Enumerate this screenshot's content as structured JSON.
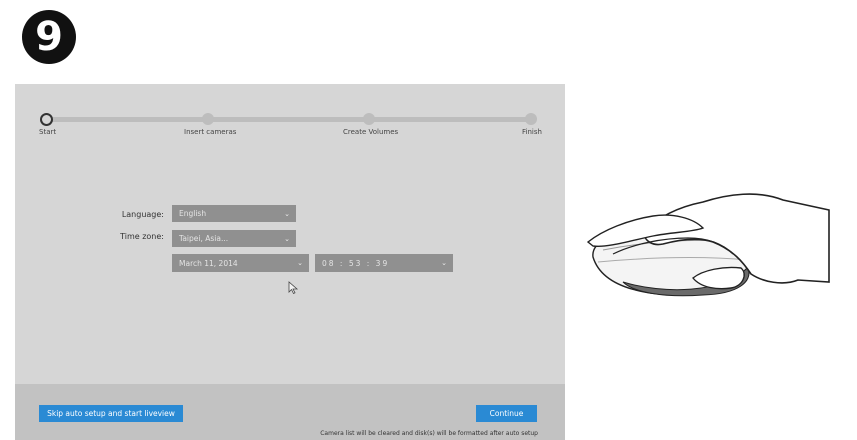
{
  "step_number": "9",
  "wizard": {
    "steps": [
      "Start",
      "Insert cameras",
      "Create Volumes",
      "Finish"
    ],
    "form": {
      "language_label": "Language:",
      "language_value": "English",
      "timezone_label": "Time zone:",
      "timezone_value": "Taipei, Asia...",
      "date_value": "March 11, 2014",
      "time_value": "08 : 53 : 39"
    },
    "footer": {
      "skip_label": "Skip auto setup and start liveview",
      "continue_label": "Continue",
      "notice": "Camera list will be cleared and disk(s) will be formatted after auto setup"
    }
  },
  "colors": {
    "panel": "#d6d6d6",
    "footer": "#c2c2c2",
    "select": "#909090",
    "button": "#2a8ad4"
  },
  "icons": [
    "chevron-down-icon",
    "mouse-pointer-icon",
    "hand-on-mouse-illustration"
  ]
}
